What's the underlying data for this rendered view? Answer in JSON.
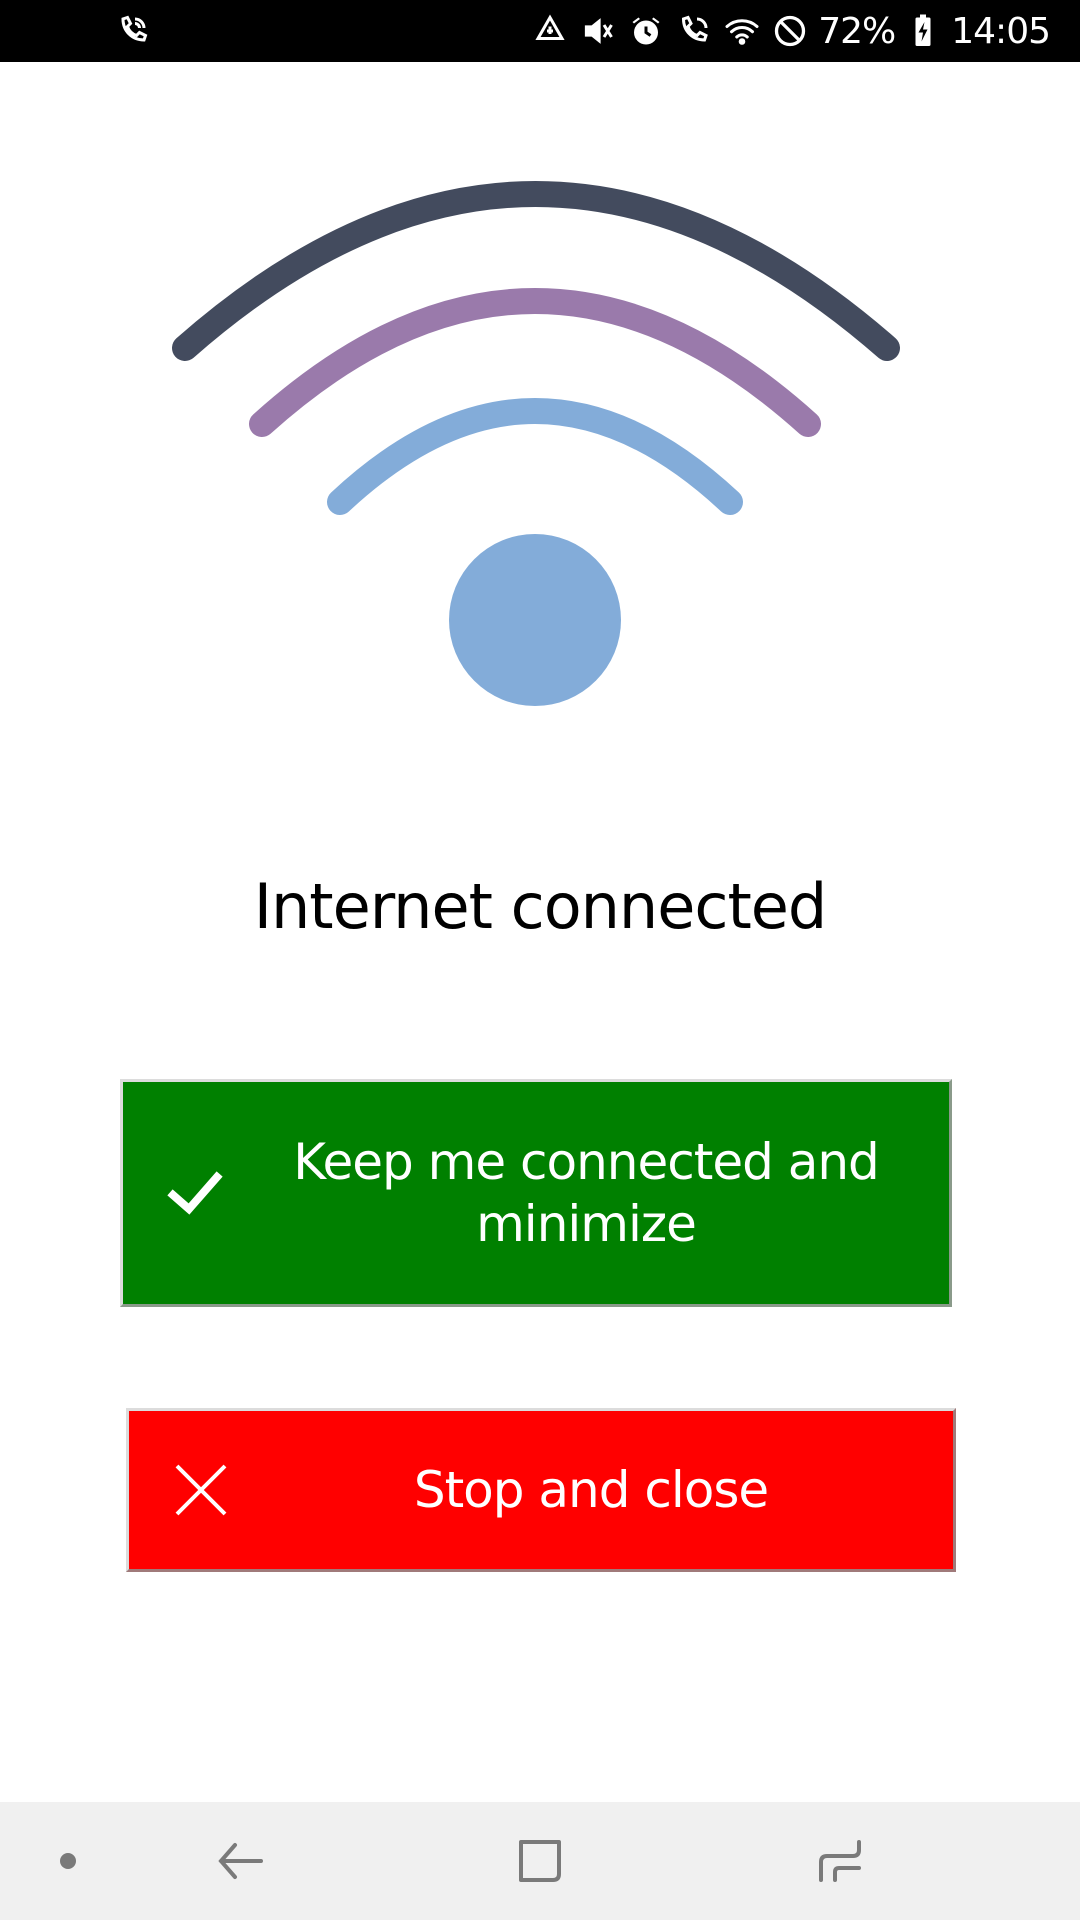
{
  "status_bar": {
    "battery_percent": "72%",
    "time": "14:05",
    "icons": [
      "wifi-calling-icon",
      "data-saver-icon",
      "mute-icon",
      "alarm-icon",
      "volte-call-icon",
      "wifi-icon",
      "do-not-disturb-icon",
      "battery-charging-icon"
    ]
  },
  "illustration": {
    "name": "wifi-signal-illustration",
    "colors": {
      "outer_arc": "#434b5e",
      "middle_arc": "#9a7aab",
      "inner_arc": "#83acd9",
      "dot": "#83acd9"
    }
  },
  "status_title": "Internet connected",
  "buttons": {
    "keep": {
      "label": "Keep me connected and minimize",
      "icon": "checkmark-icon",
      "color": "#008000"
    },
    "stop": {
      "label": "Stop and close",
      "icon": "close-icon",
      "color": "#ff0000"
    }
  },
  "nav_bar": {
    "items": [
      "nav-dot-icon",
      "back-icon",
      "home-icon",
      "recents-icon"
    ]
  }
}
